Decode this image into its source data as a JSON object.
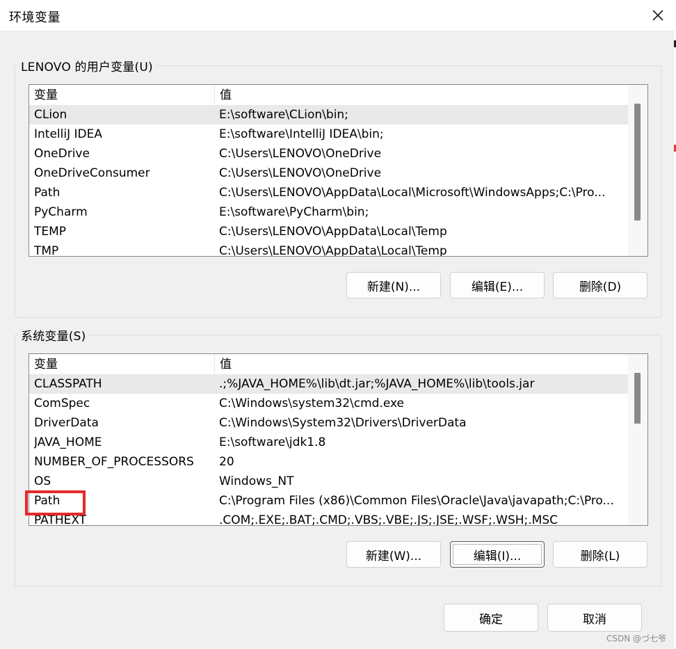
{
  "window": {
    "title": "环境变量",
    "close_icon": "close-icon"
  },
  "user_vars": {
    "legend": "LENOVO 的用户变量(U)",
    "columns": {
      "name": "变量",
      "value": "值"
    },
    "rows": [
      {
        "name": "CLion",
        "value": "E:\\software\\CLion\\bin;"
      },
      {
        "name": "IntelliJ IDEA",
        "value": "E:\\software\\IntelliJ IDEA\\bin;"
      },
      {
        "name": "OneDrive",
        "value": "C:\\Users\\LENOVO\\OneDrive"
      },
      {
        "name": "OneDriveConsumer",
        "value": "C:\\Users\\LENOVO\\OneDrive"
      },
      {
        "name": "Path",
        "value": "C:\\Users\\LENOVO\\AppData\\Local\\Microsoft\\WindowsApps;C:\\Pro..."
      },
      {
        "name": "PyCharm",
        "value": "E:\\software\\PyCharm\\bin;"
      },
      {
        "name": "TEMP",
        "value": "C:\\Users\\LENOVO\\AppData\\Local\\Temp"
      },
      {
        "name": "TMP",
        "value": "C:\\Users\\LENOVO\\AppData\\Local\\Temp"
      }
    ],
    "buttons": {
      "new": "新建(N)...",
      "edit": "编辑(E)...",
      "delete": "删除(D)"
    }
  },
  "system_vars": {
    "legend": "系统变量(S)",
    "columns": {
      "name": "变量",
      "value": "值"
    },
    "rows": [
      {
        "name": "CLASSPATH",
        "value": ".;%JAVA_HOME%\\lib\\dt.jar;%JAVA_HOME%\\lib\\tools.jar"
      },
      {
        "name": "ComSpec",
        "value": "C:\\Windows\\system32\\cmd.exe"
      },
      {
        "name": "DriverData",
        "value": "C:\\Windows\\System32\\Drivers\\DriverData"
      },
      {
        "name": "JAVA_HOME",
        "value": "E:\\software\\jdk1.8"
      },
      {
        "name": "NUMBER_OF_PROCESSORS",
        "value": "20"
      },
      {
        "name": "OS",
        "value": "Windows_NT"
      },
      {
        "name": "Path",
        "value": "C:\\Program Files (x86)\\Common Files\\Oracle\\Java\\javapath;C:\\Pro..."
      },
      {
        "name": "PATHEXT",
        "value": ".COM;.EXE;.BAT;.CMD;.VBS;.VBE;.JS;.JSE;.WSF;.WSH;.MSC"
      }
    ],
    "buttons": {
      "new": "新建(W)...",
      "edit": "编辑(I)...",
      "delete": "删除(L)"
    }
  },
  "footer": {
    "ok": "确定",
    "cancel": "取消"
  },
  "watermark": "CSDN @づ七爷",
  "colors": {
    "highlight": "#e52a2a",
    "selected_row": "#e9e9e9"
  }
}
